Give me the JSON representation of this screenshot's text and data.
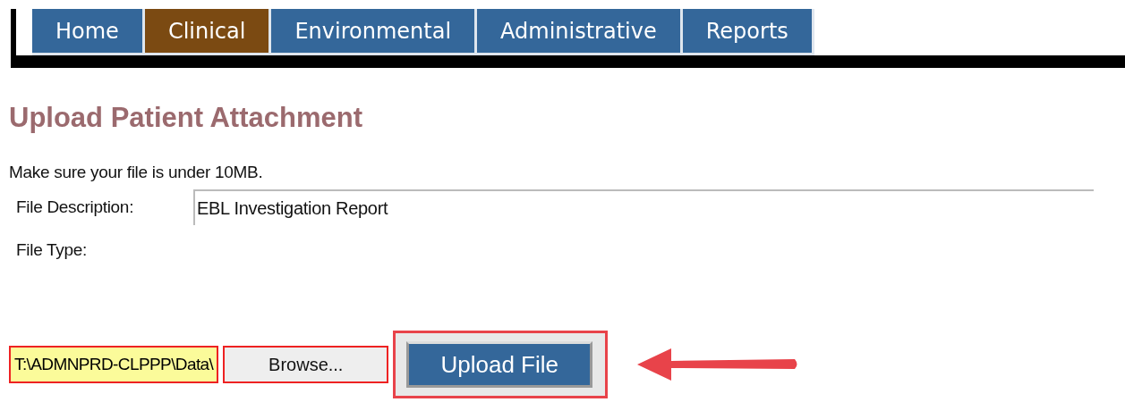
{
  "nav_tabs": [
    {
      "label": "Home",
      "selected": false
    },
    {
      "label": "Clinical",
      "selected": true
    },
    {
      "label": "Environmental",
      "selected": false
    },
    {
      "label": "Administrative",
      "selected": false
    },
    {
      "label": "Reports",
      "selected": false
    }
  ],
  "heading": "Upload Patient Attachment",
  "note": "Make sure your file is under 10MB.",
  "fields": [
    {
      "label": "File Description:",
      "value": "EBL Investigation Report",
      "kind": "text"
    },
    {
      "label": "File Type:",
      "kind": "empty"
    }
  ],
  "file_path": {
    "value": "T:\\ADMNPRD-CLPPP\\Data\\"
  },
  "browse_button": "Browse...",
  "upload_button": {
    "label": "Upload File",
    "highlighted": true
  }
}
